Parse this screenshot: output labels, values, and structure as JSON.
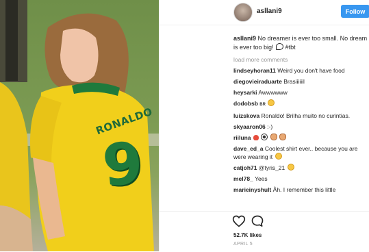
{
  "post": {
    "photo": {
      "jersey_name": "RONALDO",
      "jersey_number": "9"
    },
    "header": {
      "username": "asllani9",
      "follow_label": "Follow"
    },
    "caption": {
      "username": "asllani9",
      "text": "No dreamer is ever too small. No dream is ever too big!",
      "hashtag": "#tbt"
    },
    "load_more_label": "load more comments",
    "comments": [
      {
        "user": "lindseyhoran11",
        "text": "Weird you don't have food"
      },
      {
        "user": "diegovieiraduarte",
        "text": "Brasiiiiiil"
      },
      {
        "user": "heysarki",
        "text": "Awwwwww"
      },
      {
        "user": "dodobsb",
        "text": ""
      },
      {
        "user": "luizskova",
        "text": "Ronaldo! Brilha muito no curintias."
      },
      {
        "user": "skyaaron06",
        "text": ":-)"
      },
      {
        "user": "riiluna",
        "text": ""
      },
      {
        "user": "dave_ed_a",
        "text": "Coolest shirt ever.. because you are were wearing it"
      },
      {
        "user": "catjoh71",
        "text": "@tyris_21"
      },
      {
        "user": "mel78_",
        "text": "Yees"
      },
      {
        "user": "marieinyshult",
        "text": "Åh. I remember this little"
      }
    ],
    "emoji_tags": {
      "dodobsb": "BR"
    },
    "actions": {
      "like_icon": "heart-outline-icon",
      "comment_icon": "speech-bubble-icon"
    },
    "likes_text": "52.7K likes",
    "timestamp": "APRIL 5"
  }
}
